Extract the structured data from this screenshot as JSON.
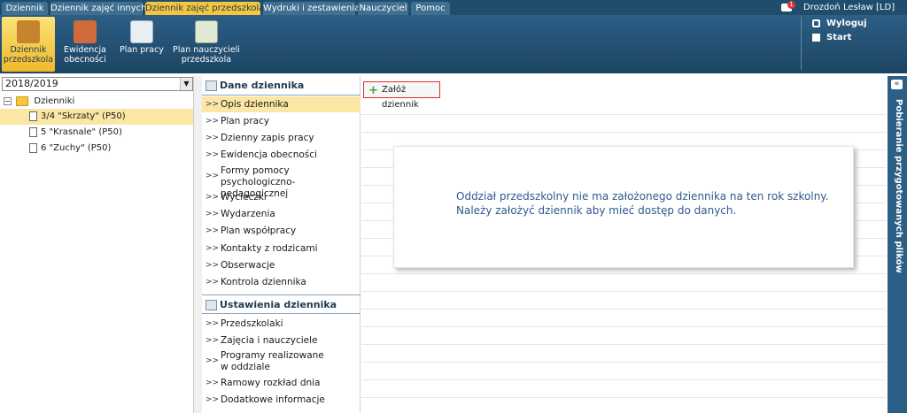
{
  "tabs": [
    {
      "label": "Dziennik",
      "active": false
    },
    {
      "label": "Dziennik zajęć innych",
      "active": false
    },
    {
      "label": "Dziennik zajęć przedszkola",
      "active": true
    },
    {
      "label": "Wydruki i zestawienia",
      "active": false
    },
    {
      "label": "Nauczyciel",
      "active": false
    },
    {
      "label": "Pomoc",
      "active": false
    }
  ],
  "user": {
    "name": "Drozdoń Lesław [LD]",
    "badge": "1"
  },
  "ribbon": {
    "buttons": [
      {
        "label": "Dziennik przedszkola",
        "active": true
      },
      {
        "label": "Ewidencja obecności",
        "active": false
      },
      {
        "label": "Plan pracy",
        "active": false
      },
      {
        "label": "Plan nauczycieli przedszkola",
        "active": false
      }
    ],
    "logout": "Wyloguj",
    "start": "Start"
  },
  "year_select": {
    "value": "2018/2019"
  },
  "tree": {
    "root": "Dzienniki",
    "items": [
      {
        "label": "3/4 \"Skrzaty\" (P50)",
        "selected": true
      },
      {
        "label": "5 \"Krasnale\" (P50)",
        "selected": false
      },
      {
        "label": "6 \"Zuchy\" (P50)",
        "selected": false
      }
    ]
  },
  "menu": {
    "section1": "Dane dziennika",
    "items1": [
      "Opis dziennika",
      "Plan pracy",
      "Dzienny zapis pracy",
      "Ewidencja obecności",
      "Formy pomocy psychologiczno-pedagogicznej",
      "Wycieczki",
      "Wydarzenia",
      "Plan współpracy",
      "Kontakty z rodzicami",
      "Obserwacje",
      "Kontrola dziennika"
    ],
    "section2": "Ustawienia dziennika",
    "items2": [
      "Przedszkolaki",
      "Zajęcia i nauczyciele",
      "Programy realizowane w oddziale",
      "Ramowy rozkład dnia",
      "Dodatkowe informacje"
    ]
  },
  "content": {
    "create_button": "Załóż dziennik",
    "message_line1": "Oddział przedszkolny nie ma założonego dziennika na ten rok szkolny.",
    "message_line2": "Należy założyć dziennik aby mieć dostęp do danych."
  },
  "sidebar_right": {
    "label": "Pobieranie przygotowanych plików"
  },
  "colors": {
    "nav": "#1f4d6e",
    "active_tab": "#f3c540",
    "selection": "#fbe6a3",
    "message": "#2d5a8c"
  }
}
